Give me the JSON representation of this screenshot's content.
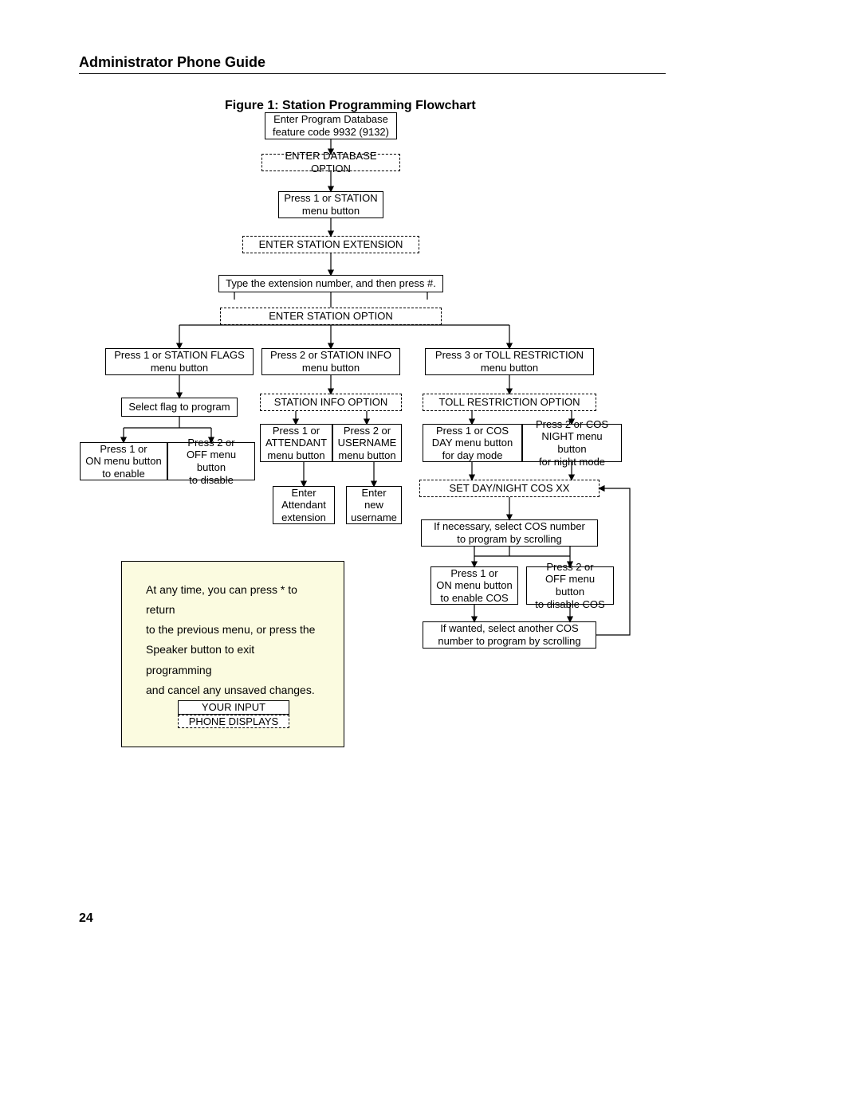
{
  "header": "Administrator Phone Guide",
  "figure_title": "Figure 1: Station Programming Flowchart",
  "page_number": "24",
  "nodes": {
    "n1": {
      "l1": "Enter Program Database",
      "l2": "feature code 9932 (9132)"
    },
    "n2": {
      "l1": "ENTER DATABASE OPTION"
    },
    "n3": {
      "l1": "Press 1 or STATION",
      "l2": "menu button"
    },
    "n4": {
      "l1": "ENTER STATION EXTENSION"
    },
    "n5": {
      "l1": "Type the extension number, and then press #."
    },
    "n6": {
      "l1": "ENTER STATION OPTION"
    },
    "n7": {
      "l1": "Press 1 or STATION FLAGS",
      "l2": "menu button"
    },
    "n8": {
      "l1": "Press 2 or STATION INFO",
      "l2": "menu button"
    },
    "n9": {
      "l1": "Press 3 or TOLL RESTRICTION",
      "l2": "menu button"
    },
    "n10": {
      "l1": "Select flag to program"
    },
    "n11": {
      "l1": "Press 1 or",
      "l2": "ON menu button",
      "l3": "to enable"
    },
    "n12": {
      "l1": "Press 2 or",
      "l2": "OFF menu button",
      "l3": "to disable"
    },
    "n13": {
      "l1": "STATION INFO OPTION"
    },
    "n14": {
      "l1": "Press 1 or",
      "l2": "ATTENDANT",
      "l3": "menu button"
    },
    "n15": {
      "l1": "Press 2 or",
      "l2": "USERNAME",
      "l3": "menu button"
    },
    "n16": {
      "l1": "Enter",
      "l2": "Attendant",
      "l3": "extension"
    },
    "n17": {
      "l1": "Enter",
      "l2": "new",
      "l3": "username"
    },
    "n18": {
      "l1": "TOLL RESTRICTION OPTION"
    },
    "n19": {
      "l1": "Press 1 or COS",
      "l2": "DAY menu button",
      "l3": "for day mode"
    },
    "n20": {
      "l1": "Press 2 or COS",
      "l2": "NIGHT menu button",
      "l3": "for night mode"
    },
    "n21": {
      "l1": "SET DAY/NIGHT COS XX"
    },
    "n22": {
      "l1": "If necessary, select COS number",
      "l2": "to program by scrolling"
    },
    "n23": {
      "l1": "Press 1 or",
      "l2": "ON menu button",
      "l3": "to enable COS"
    },
    "n24": {
      "l1": "Press 2 or",
      "l2": "OFF menu button",
      "l3": "to disable COS"
    },
    "n25": {
      "l1": "If wanted, select another COS",
      "l2": "number to program by scrolling"
    }
  },
  "note": {
    "l1": "At any time, you can press * to return",
    "l2": "to the previous menu, or press the",
    "l3": "Speaker button to exit programming",
    "l4": "and cancel any unsaved changes."
  },
  "legend": {
    "input_label": "YOUR INPUT",
    "display_label": "PHONE DISPLAYS"
  }
}
